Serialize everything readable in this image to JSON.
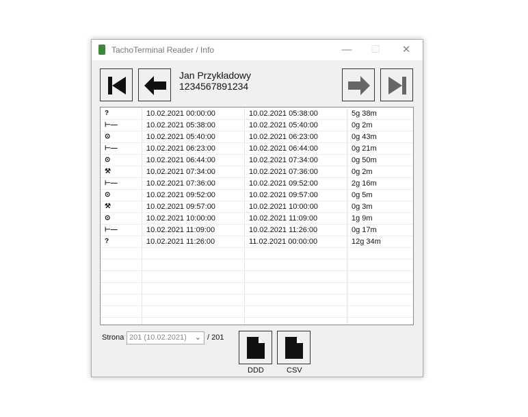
{
  "window": {
    "title": "TachoTerminal Reader / Info",
    "minimize": "—",
    "maximize": "☐",
    "close": "✕"
  },
  "driver": {
    "name": "Jan Przykładowy",
    "card_number": "1234567891234"
  },
  "nav": {
    "first": "first-page-icon",
    "prev": "prev-page-icon",
    "next": "next-page-icon",
    "last": "last-page-icon"
  },
  "activities": [
    {
      "icon": "unknown",
      "start": "10.02.2021 00:00:00",
      "end": "10.02.2021 05:38:00",
      "duration": "5g 38m"
    },
    {
      "icon": "rest",
      "start": "10.02.2021 05:38:00",
      "end": "10.02.2021 05:40:00",
      "duration": "0g 2m"
    },
    {
      "icon": "driving",
      "start": "10.02.2021 05:40:00",
      "end": "10.02.2021 06:23:00",
      "duration": "0g 43m"
    },
    {
      "icon": "rest",
      "start": "10.02.2021 06:23:00",
      "end": "10.02.2021 06:44:00",
      "duration": "0g 21m"
    },
    {
      "icon": "driving",
      "start": "10.02.2021 06:44:00",
      "end": "10.02.2021 07:34:00",
      "duration": "0g 50m"
    },
    {
      "icon": "work",
      "start": "10.02.2021 07:34:00",
      "end": "10.02.2021 07:36:00",
      "duration": "0g 2m"
    },
    {
      "icon": "rest",
      "start": "10.02.2021 07:36:00",
      "end": "10.02.2021 09:52:00",
      "duration": "2g 16m"
    },
    {
      "icon": "driving",
      "start": "10.02.2021 09:52:00",
      "end": "10.02.2021 09:57:00",
      "duration": "0g 5m"
    },
    {
      "icon": "work",
      "start": "10.02.2021 09:57:00",
      "end": "10.02.2021 10:00:00",
      "duration": "0g 3m"
    },
    {
      "icon": "driving",
      "start": "10.02.2021 10:00:00",
      "end": "10.02.2021 11:09:00",
      "duration": "1g 9m"
    },
    {
      "icon": "rest",
      "start": "10.02.2021 11:09:00",
      "end": "10.02.2021 11:26:00",
      "duration": "0g 17m"
    },
    {
      "icon": "unknown",
      "start": "10.02.2021 11:26:00",
      "end": "11.02.2021 00:00:00",
      "duration": "12g 34m"
    }
  ],
  "icon_glyphs": {
    "unknown": "?",
    "rest": "⊢—",
    "driving": "⊙",
    "work": "⚒"
  },
  "footer": {
    "page_label": "Strona",
    "page_select": "201 (10.02.2021)",
    "page_total": "/ 201",
    "ddd_label": "DDD",
    "csv_label": "CSV"
  }
}
